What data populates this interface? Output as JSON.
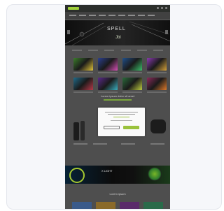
{
  "site": {
    "hero_title": "SPELL",
    "hero_subtitle": "Jbl",
    "section_title": "Lorem ipsum dolor sit amet",
    "promo_title": "X LIGHT",
    "footer_title": "Lorem ipsum"
  },
  "consent": {
    "title": "",
    "link": "",
    "decline_label": "",
    "accept_label": ""
  },
  "colors": {
    "accent": "#9ac23c",
    "page_bg": "#4e4e4e",
    "card_bg": "#f6f7fa"
  },
  "tiles": [
    {
      "c1": "#3b7d2a",
      "c2": "#e0c33a"
    },
    {
      "c1": "#2b3f8f",
      "c2": "#d64fb5"
    },
    {
      "c1": "#1f4f8a",
      "c2": "#3bbf6a"
    },
    {
      "c1": "#8a3ab0",
      "c2": "#d6a23a"
    },
    {
      "c1": "#1f6b8a",
      "c2": "#b83a4a"
    },
    {
      "c1": "#5a2a8a",
      "c2": "#3ab0c0"
    },
    {
      "c1": "#2a6b3a",
      "c2": "#c0d040"
    },
    {
      "c1": "#8a2a5a",
      "c2": "#e07a2a"
    }
  ]
}
